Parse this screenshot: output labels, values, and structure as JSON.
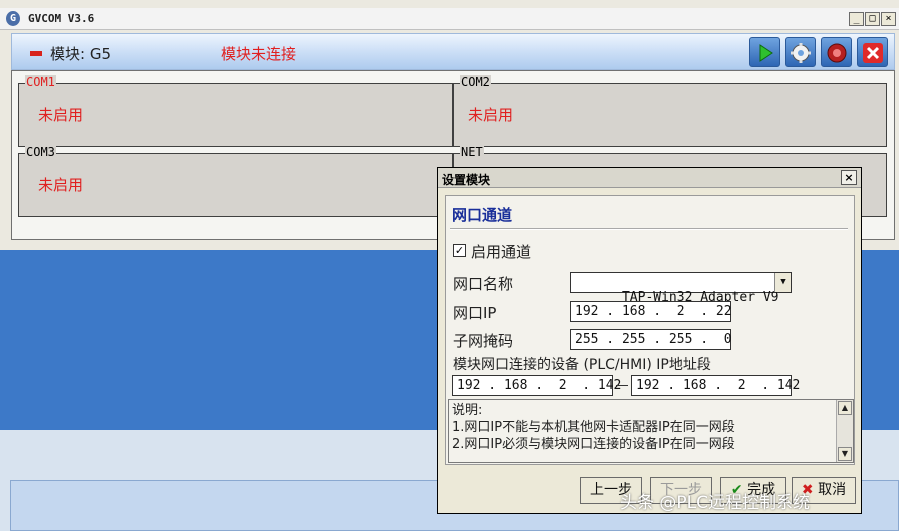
{
  "app": {
    "title": "GVCOM  V3.6",
    "icon_letter": "G"
  },
  "header": {
    "module_label": "模块: G5",
    "module_status": "模块未连接",
    "indicator_color": "#d8231c",
    "toolbar": {
      "run": "play-icon",
      "settings": "gear-icon",
      "record": "record-icon",
      "close": "close-icon"
    }
  },
  "ports": [
    {
      "name": "COM1",
      "status": "未启用"
    },
    {
      "name": "COM2",
      "status": "未启用"
    },
    {
      "name": "COM3",
      "status": "未启用"
    },
    {
      "name": "NET",
      "status": ""
    }
  ],
  "dialog": {
    "title": "设置模块",
    "section_title": "网口通道",
    "enable_label": "启用通道",
    "enable_checked": true,
    "adapter_label": "网口名称",
    "adapter_value": "TAP-Win32 Adapter V9",
    "ip_label": "网口IP",
    "ip_value": "192 . 168 .  2  . 22",
    "mask_label": "子网掩码",
    "mask_value": "255 . 255 . 255 .  0",
    "range_label": "模块网口连接的设备 (PLC/HMI) IP地址段",
    "range_start": "192 . 168 .  2  . 142",
    "range_end": "192 . 168 .  2  . 142",
    "notes_title": "说明:",
    "notes": [
      "1.网口IP不能与本机其他网卡适配器IP在同一网段",
      "2.网口IP必须与模块网口连接的设备IP在同一网段"
    ],
    "buttons": {
      "prev": "上一步",
      "next": "下一步",
      "finish": "完成",
      "cancel": "取消"
    }
  },
  "watermark": "头条 @PLC远程控制系统"
}
